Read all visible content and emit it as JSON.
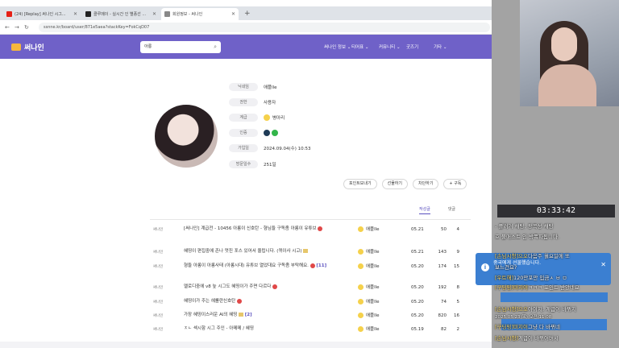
{
  "browser": {
    "tabs": [
      {
        "title": "(24) [Replay] 써나인 시그...",
        "favicon_color": "#e62117",
        "active": false
      },
      {
        "title": "클루메이 - 실시간 인 별풍선 ...",
        "favicon_color": "#222222",
        "active": false
      },
      {
        "title": "회원정보 - 써나인",
        "favicon_color": "#888888",
        "active": true
      }
    ],
    "new_tab": "+",
    "url": "ssnne.kr/board/user/871e5aea?stackKey=FokCqD07"
  },
  "site": {
    "logo": "써나인",
    "search_value": "아롱",
    "menu": [
      "써나인 정보 ⌄",
      "티어표 ⌄",
      "커뮤니티 ⌄",
      "굿즈기",
      "기타 ⌄"
    ]
  },
  "profile": {
    "rows": [
      {
        "label": "닉네임",
        "value": "애플lle"
      },
      {
        "label": "권한",
        "value": "사용자"
      },
      {
        "label": "계급",
        "value": "병아리"
      },
      {
        "label": "인증",
        "value": ""
      },
      {
        "label": "가입일",
        "value": "2024.09.04(수) 10:53"
      },
      {
        "label": "방문일수",
        "value": "251일"
      }
    ],
    "buttons": [
      "포인트보내기",
      "선물하기",
      "차단하기",
      "+ 구독"
    ]
  },
  "list_tabs": [
    "작성글",
    "댓글"
  ],
  "posts": [
    {
      "cat": "써나인",
      "title": "[써나인] 계급전 - 10456 아롱이 신호탄 - 형님들 구독좀 아롱이 유튜브",
      "comments": "",
      "author": "애플lle",
      "date": "05.21",
      "views": "50",
      "count": "4"
    },
    {
      "cat": "써나인",
      "title": "혜띵이 편집중에 존나 멋진 포스 있어서 올립니다. (퀴이사 시고)",
      "comments": "",
      "author": "애플lle",
      "date": "05.21",
      "views": "143",
      "count": "9"
    },
    {
      "cat": "써나인",
      "title": "형들 아롱이 아롱사태 (아롱시대) 유튜브 열었대요 구독좀 부탁해요.",
      "comments": "[11]",
      "author": "애플lle",
      "date": "05.20",
      "views": "174",
      "count": "15"
    },
    {
      "cat": "써나인",
      "title": "멜로디중에 v8 늪 시그도 혜띵이가 주면 다르다",
      "comments": "",
      "author": "애플lle",
      "date": "05.20",
      "views": "192",
      "count": "8"
    },
    {
      "cat": "써나인",
      "title": "혜띵이가 주는 헤롤란신호탄",
      "comments": "",
      "author": "애플lle",
      "date": "05.20",
      "views": "74",
      "count": "5"
    },
    {
      "cat": "써나인",
      "title": "가장 혜띵이스러운 AI의 혜띵",
      "comments": "[2]",
      "author": "애플lle",
      "date": "05.20",
      "views": "820",
      "count": "16"
    },
    {
      "cat": "써나인",
      "title": "ㅈㄴ 섹시함 시그 주인 - 아메메 / 혜띵",
      "comments": "",
      "author": "애플lle",
      "date": "05.19",
      "views": "82",
      "count": "2"
    }
  ],
  "stream": {
    "timer": "03:33:42",
    "chat": [
      {
        "name": "",
        "text": "- 플러거 채팅, 광곡성 채팅"
      },
      {
        "name": "",
        "text": "호 불매스트 인 방폭파됩니다."
      },
      {
        "name": "[손님시청]으오",
        "text": "다음주 월요일에 또"
      },
      {
        "name": "",
        "text": "보느건요?"
      },
      {
        "name": "[우트해]",
        "text": "120만포만 입금ㅅ ㅂ ㅁ"
      },
      {
        "name": "[구딩밍]미지이",
        "text": "ㅋㅋㅋ 포인트 받았네요"
      },
      {
        "name": "[손님시청]으오",
        "text": "아이지, 계급이 바뀌지"
      },
      {
        "name": "[구딩밍]미지이",
        "text": "그냥 다 바뀌네"
      },
      {
        "name": "[손님시청]",
        "text": "계급이 바뀌어버시"
      }
    ],
    "notice_title": "중국에게 선물했습니다.",
    "notice_sub": "2025.05.23(목) 오전 11:08",
    "notice_close": "✕"
  }
}
